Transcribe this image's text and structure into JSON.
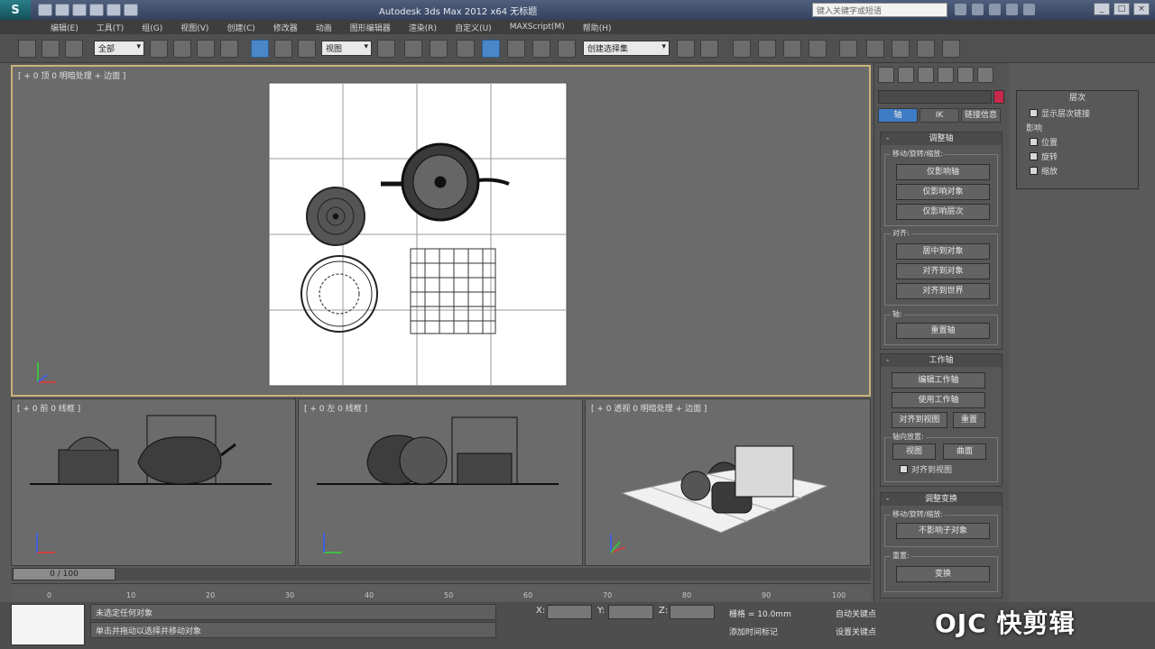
{
  "titlebar": {
    "app_logo": "S",
    "title": "Autodesk 3ds Max 2012 x64    无标题",
    "search_placeholder": "键入关键字或短语"
  },
  "menubar": {
    "items": [
      "编辑(E)",
      "工具(T)",
      "组(G)",
      "视图(V)",
      "创建(C)",
      "修改器",
      "动画",
      "图形编辑器",
      "渲染(R)",
      "自定义(U)",
      "MAXScript(M)",
      "帮助(H)"
    ]
  },
  "toolbar": {
    "selection_filter": "全部",
    "ref_coord": "视图",
    "named_selection": "创建选择集"
  },
  "viewports": {
    "top": "[ + 0 顶 0 明暗处理 + 边面 ]",
    "front": "[ + 0 前 0 线框 ]",
    "left": "[ + 0 左 0 线框 ]",
    "perspective": "[ + 0 透视 0 明暗处理 + 边面 ]"
  },
  "timeline": {
    "frame_counter": "0 / 100",
    "ticks": [
      "0",
      "10",
      "20",
      "30",
      "40",
      "50",
      "60",
      "70",
      "80",
      "90",
      "100"
    ]
  },
  "status": {
    "line1": "未选定任何对象",
    "line2": "单击并拖动以选择并移动对象",
    "x_label": "X:",
    "y_label": "Y:",
    "z_label": "Z:",
    "grid": "栅格 = 10.0mm",
    "add_time_tag": "添加时间标记",
    "auto_key": "自动关键点",
    "set_key": "设置关键点"
  },
  "command_panel": {
    "pivot_tabs": [
      "轴",
      "IK",
      "链接信息"
    ],
    "adjust_pivot": {
      "title": "调整轴",
      "move_group": "移动/旋转/缩放:",
      "buttons": [
        "仅影响轴",
        "仅影响对象",
        "仅影响层次"
      ],
      "align_group": "对齐:",
      "align_buttons": [
        "居中到对象",
        "对齐到对象",
        "对齐到世界"
      ],
      "pivot_group": "轴:",
      "reset_button": "重置轴"
    },
    "working_pivot": {
      "title": "工作轴",
      "buttons": [
        "编辑工作轴",
        "使用工作轴"
      ],
      "align_view": "对齐到视图",
      "reset": "重置",
      "placement_group": "轴向放置:",
      "place_buttons": [
        "视图",
        "曲面"
      ],
      "align_check": "对齐到视图"
    },
    "adjust_transform": {
      "title": "调整变换",
      "move_group": "移动/旋转/缩放:",
      "dont_affect": "不影响子对象",
      "reset_group": "重置:",
      "transform_button": "变换"
    }
  },
  "floating_panel": {
    "title": "层次",
    "check1": "显示层次链接",
    "section": "影响",
    "options": [
      "位置",
      "旋转",
      "缩放"
    ]
  },
  "watermark": "OJC 快剪辑"
}
